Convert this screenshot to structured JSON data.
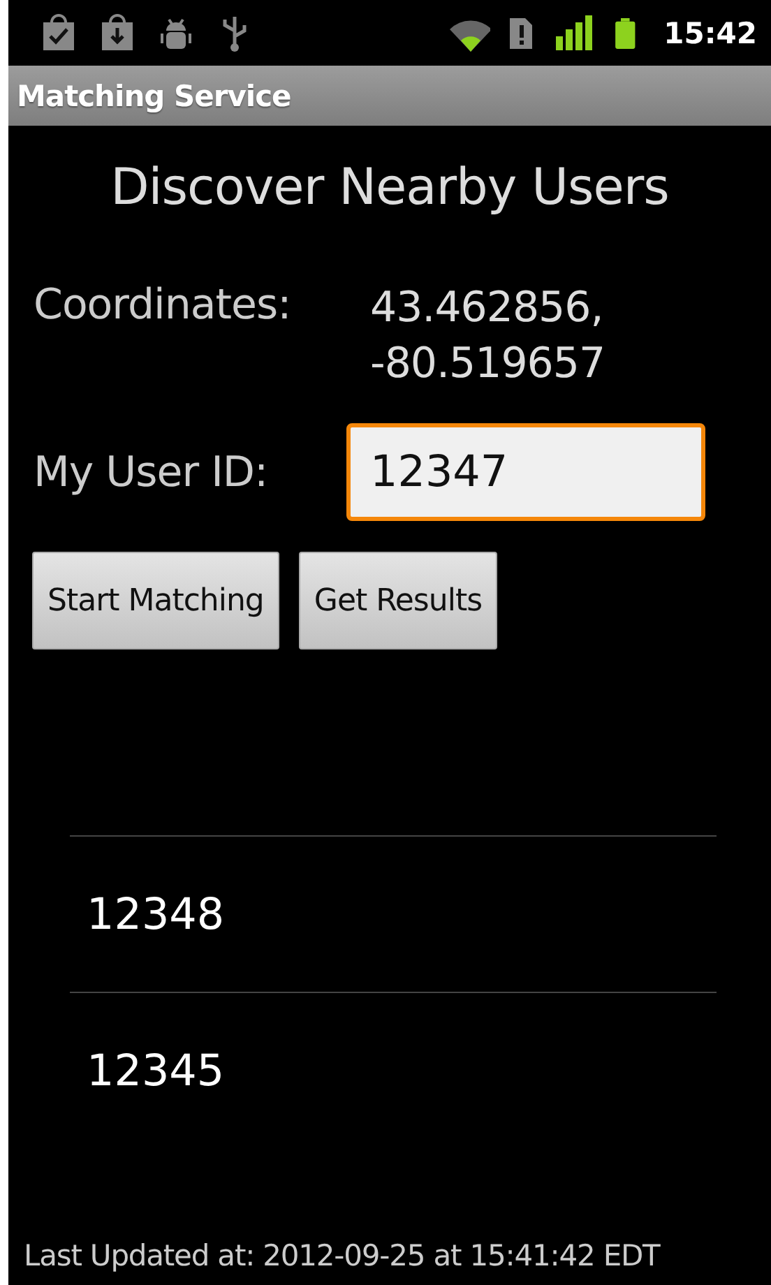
{
  "status_bar": {
    "time": "15:42"
  },
  "action_bar": {
    "title": "Matching Service"
  },
  "heading": "Discover Nearby Users",
  "coordinates": {
    "label": "Coordinates:",
    "lines": [
      "43.462856,",
      "-80.519657"
    ]
  },
  "user_id": {
    "label": "My User ID:",
    "value": "12347",
    "focused": true
  },
  "buttons": [
    "Start Matching",
    "Get Results"
  ],
  "results": [
    "12348",
    "12345"
  ],
  "footer": "Last Updated at: 2012-09-25 at 15:41:42 EDT"
}
